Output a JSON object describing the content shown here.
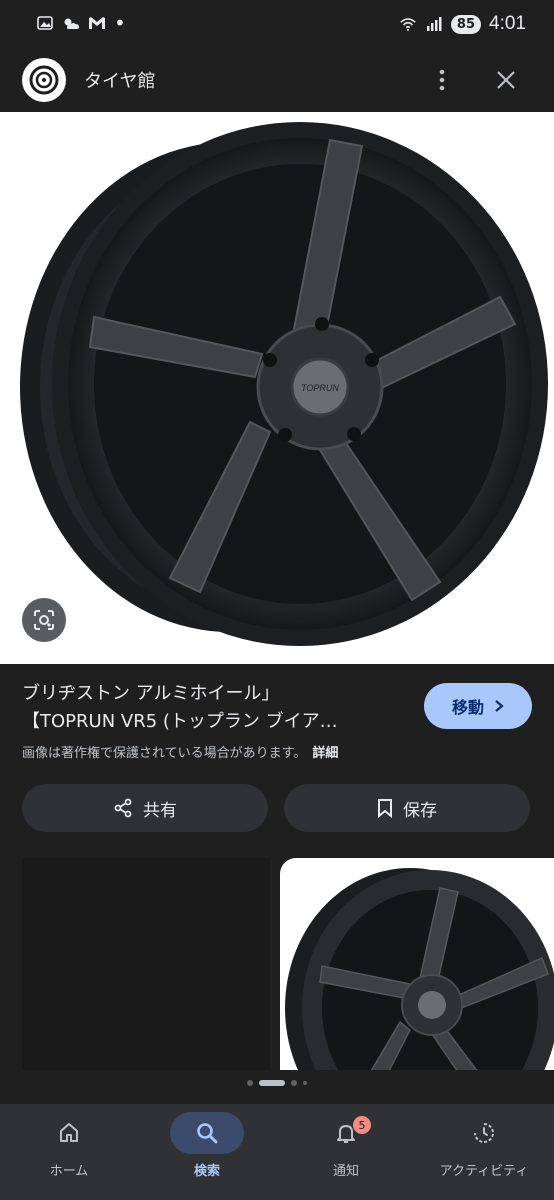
{
  "status_bar": {
    "time": "4:01",
    "battery": "85",
    "icons": [
      "gallery-icon",
      "weather-icon",
      "gmail-icon",
      "dot-icon",
      "wifi-icon",
      "signal-icon"
    ]
  },
  "header": {
    "site_name": "タイヤ館",
    "menu_icon": "more-vert-icon",
    "close_icon": "close-icon"
  },
  "result": {
    "title_line1": "ブリヂストン アルミホイール」",
    "title_line2": "【TOPRUN VR5 (トップラン ブイア…",
    "visit_label": "移動",
    "copyright_text": "画像は著作権で保護されている場合があります。",
    "details_label": "詳細",
    "share_label": "共有",
    "save_label": "保存",
    "hub_logo_text": "TOPRUN"
  },
  "pager": {
    "count": 4,
    "active_index": 1
  },
  "bottom_nav": {
    "items": [
      {
        "label": "ホーム",
        "icon": "home-icon"
      },
      {
        "label": "検索",
        "icon": "search-icon"
      },
      {
        "label": "通知",
        "icon": "bell-icon"
      },
      {
        "label": "アクティビティ",
        "icon": "activity-icon"
      }
    ],
    "active_index": 1,
    "notification_badge": "5"
  },
  "colors": {
    "background": "#1f1f1f",
    "accent": "#a8c7fa",
    "surface": "#303134"
  }
}
